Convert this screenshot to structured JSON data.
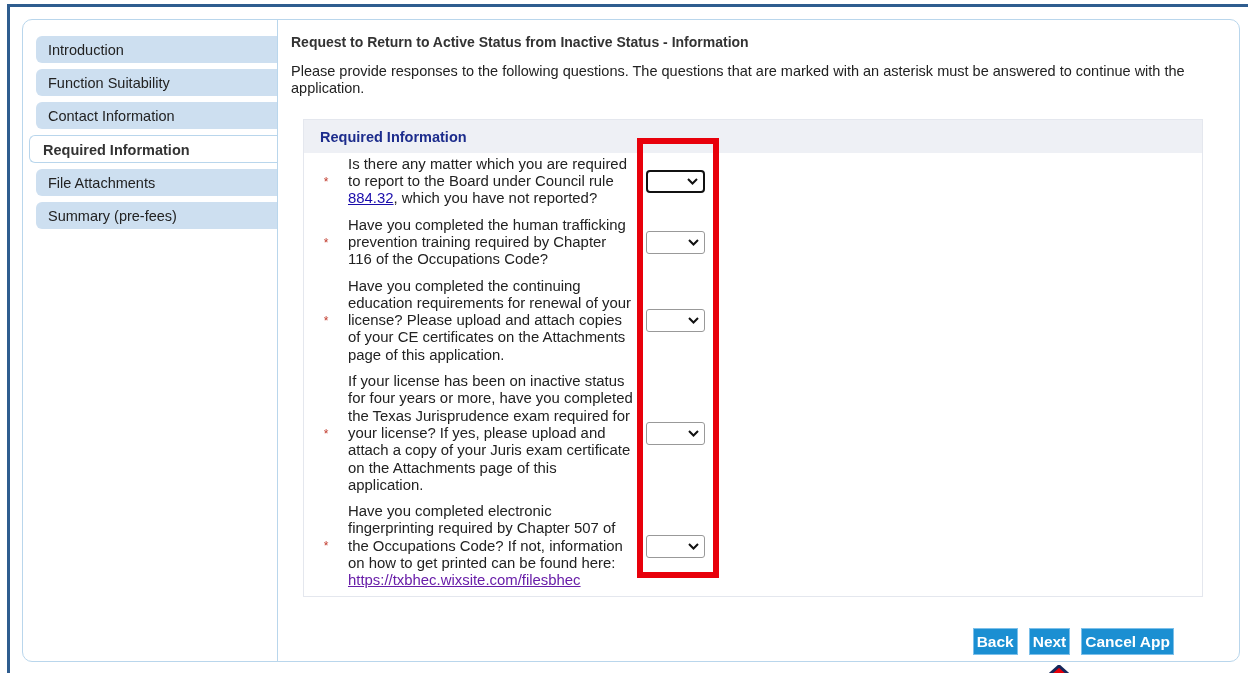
{
  "steps": [
    {
      "label": "Introduction",
      "selected": false
    },
    {
      "label": "Function Suitability",
      "selected": false
    },
    {
      "label": "Contact Information",
      "selected": false
    },
    {
      "label": "Required Information",
      "selected": true
    },
    {
      "label": "File Attachments",
      "selected": false
    },
    {
      "label": "Summary (pre-fees)",
      "selected": false
    }
  ],
  "page_title": "Request to Return to Active Status from Inactive Status - Information",
  "intro": "Please provide responses to the following questions. The questions that are marked with an asterisk must be answered to continue with the application.",
  "section": {
    "title": "Required Information",
    "questions": [
      {
        "required": true,
        "asterisk": "*",
        "focused": true,
        "parts": [
          {
            "text": "Is there any matter which you are required to report to the Board under Council rule "
          },
          {
            "link": "884.32"
          },
          {
            "text": ", which you have not reported?"
          }
        ]
      },
      {
        "required": true,
        "asterisk": "*",
        "focused": false,
        "parts": [
          {
            "text": "Have you completed the human trafficking prevention training required by Chapter 116 of the Occupations Code?"
          }
        ]
      },
      {
        "required": true,
        "asterisk": "*",
        "focused": false,
        "parts": [
          {
            "text": "Have you completed the continuing education requirements for renewal of your license? Please upload and attach copies of your CE certificates on the Attachments page of this application."
          }
        ]
      },
      {
        "required": true,
        "asterisk": "*",
        "focused": false,
        "parts": [
          {
            "text": "If your license has been on inactive status for four years or more, have you completed the Texas Jurisprudence exam required for your license? If yes, please upload and attach a copy of your Juris exam certificate on the Attachments page of this application."
          }
        ]
      },
      {
        "required": true,
        "asterisk": "*",
        "focused": false,
        "parts": [
          {
            "text": "Have you completed electronic fingerprinting required by Chapter 507 of the Occupations Code? If not, information on how to get printed can be found here: "
          },
          {
            "link": "https://txbhec.wixsite.com/filesbhec",
            "visited": true
          }
        ]
      }
    ]
  },
  "buttons": [
    "Back",
    "Next",
    "Cancel App"
  ]
}
